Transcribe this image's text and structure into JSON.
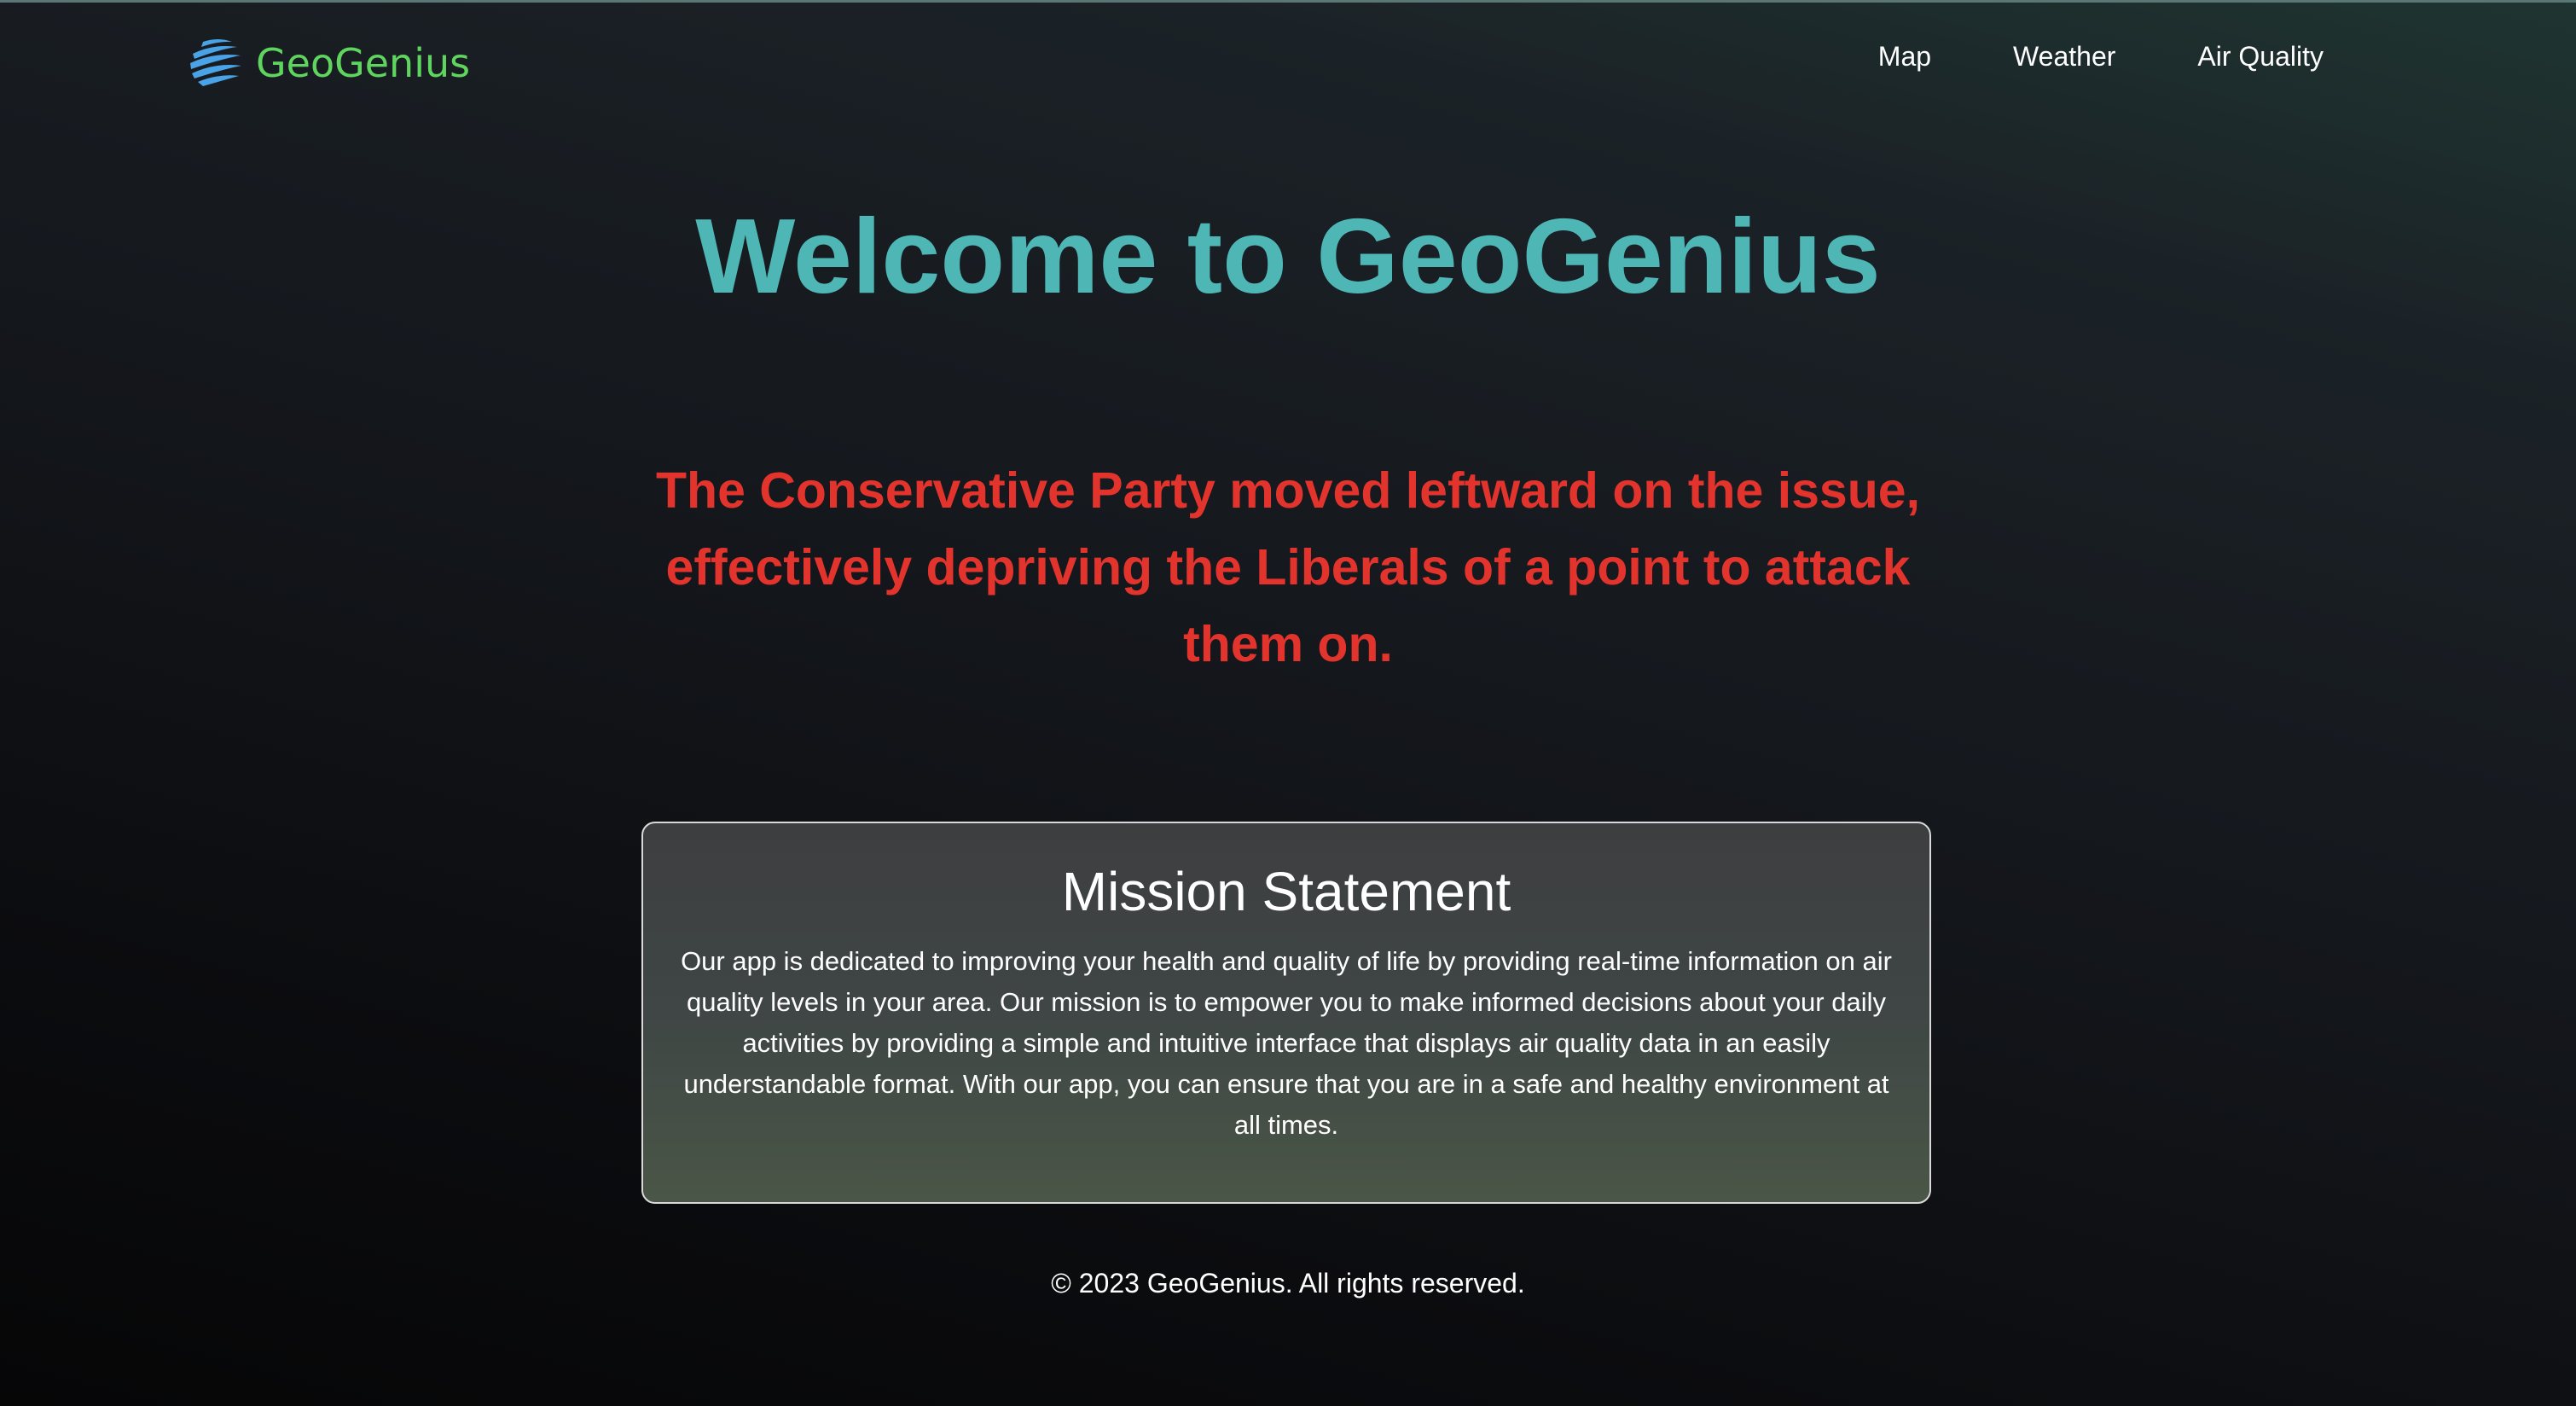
{
  "brand": {
    "name": "GeoGenius",
    "icon": "globe-swoosh-icon",
    "color": "#5fd45e",
    "icon_color": "#4aa3e6"
  },
  "nav": {
    "items": [
      {
        "label": "Map"
      },
      {
        "label": "Weather"
      },
      {
        "label": "Air Quality"
      }
    ]
  },
  "hero": {
    "title": "Welcome to GeoGenius",
    "title_color": "#4fb6b6",
    "quote": "The Conservative Party moved leftward on the issue, effectively depriving the Liberals of a point to attack them on.",
    "quote_color": "#e2342c"
  },
  "mission": {
    "title": "Mission Statement",
    "body": "Our app is dedicated to improving your health and quality of life by providing real-time information on air quality levels in your area. Our mission is to empower you to make informed decisions about your daily activities by providing a simple and intuitive interface that displays air quality data in an easily understandable format. With our app, you can ensure that you are in a safe and healthy environment at all times."
  },
  "footer": {
    "text": "© 2023 GeoGenius. All rights reserved."
  }
}
